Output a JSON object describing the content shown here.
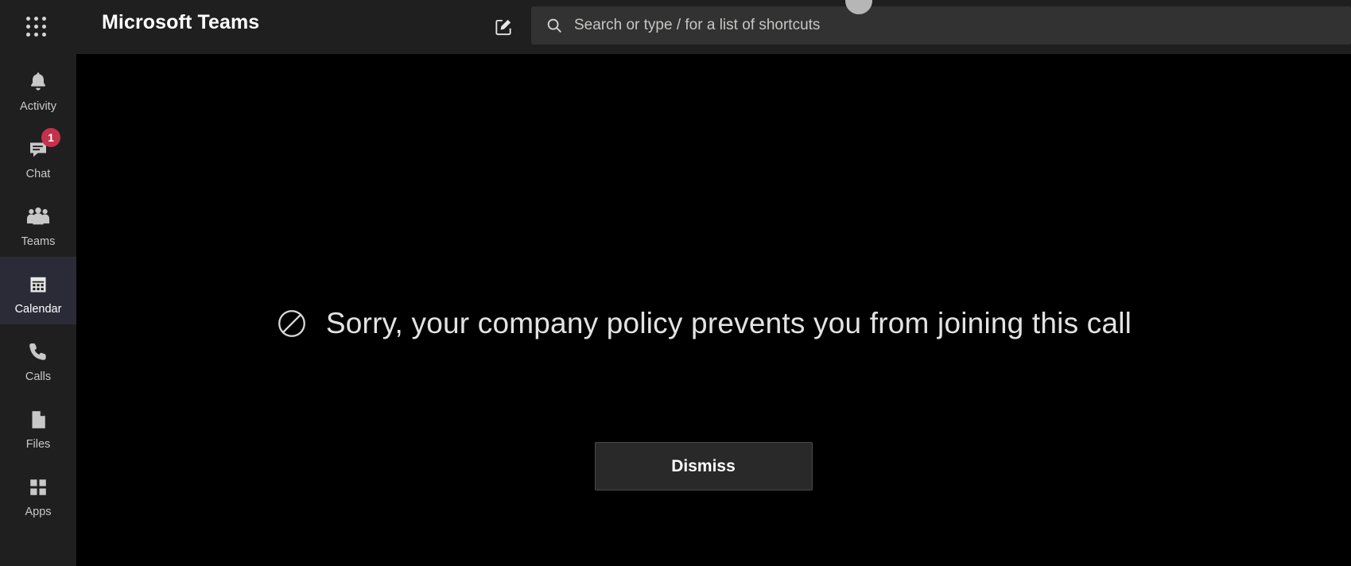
{
  "header": {
    "waffle_icon": "app-launcher-icon",
    "title": "Microsoft Teams",
    "compose_icon": "compose-new-chat-icon",
    "search": {
      "icon": "search-icon",
      "placeholder": "Search or type / for a list of shortcuts",
      "value": ""
    },
    "avatar": "user-avatar"
  },
  "sidebar": {
    "items": [
      {
        "label": "Activity",
        "icon": "bell-icon",
        "active": false,
        "badge": ""
      },
      {
        "label": "Chat",
        "icon": "chat-icon",
        "active": false,
        "badge": "1"
      },
      {
        "label": "Teams",
        "icon": "teams-icon",
        "active": false,
        "badge": ""
      },
      {
        "label": "Calendar",
        "icon": "calendar-icon",
        "active": true,
        "badge": ""
      },
      {
        "label": "Calls",
        "icon": "phone-icon",
        "active": false,
        "badge": ""
      },
      {
        "label": "Files",
        "icon": "file-icon",
        "active": false,
        "badge": ""
      },
      {
        "label": "Apps",
        "icon": "apps-grid-icon",
        "active": false,
        "badge": ""
      }
    ]
  },
  "main": {
    "block_icon": "blocked-circle-slash-icon",
    "message": "Sorry, your company policy prevents you from joining this call",
    "dismiss_label": "Dismiss"
  },
  "colors": {
    "rail_background": "#1f1f1f",
    "content_background": "#000000",
    "active_item_background": "#2b2b38",
    "badge_red": "#c4314b",
    "search_background": "#323232",
    "button_background": "#292929"
  }
}
